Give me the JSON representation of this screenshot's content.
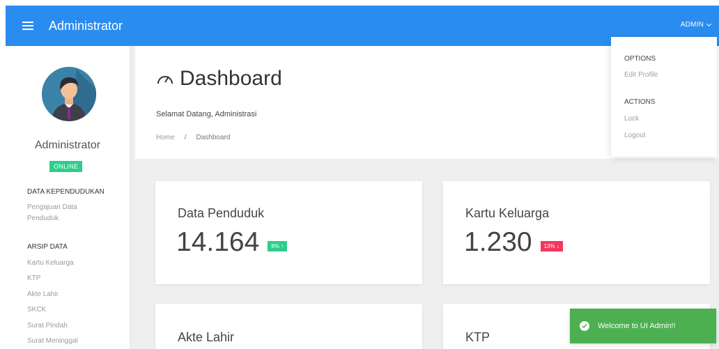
{
  "topbar": {
    "title": "Administrator",
    "user_menu_label": "ADMIN"
  },
  "sidebar": {
    "user_name": "Administrator",
    "status": "ONLINE",
    "sections": [
      {
        "header": "DATA KEPENDUDUKAN",
        "items": [
          "Pengajuan Data Penduduk"
        ]
      },
      {
        "header": "ARSIP DATA",
        "items": [
          "Kartu Keluarga",
          "KTP",
          "Akte Lahir",
          "SKCK",
          "Surat Pindah",
          "Surat Meninggal"
        ]
      }
    ]
  },
  "header": {
    "title": "Dashboard",
    "welcome": "Selamat Datang, Administrasi",
    "breadcrumb": [
      "Home",
      "/",
      "Dashboard"
    ]
  },
  "dropdown": {
    "options_header": "OPTIONS",
    "options": [
      "Edit Profile"
    ],
    "actions_header": "ACTIONS",
    "actions": [
      "Lock",
      "Logout"
    ]
  },
  "cards": [
    {
      "title": "Data Penduduk",
      "value": "14.164",
      "trend": "8%",
      "trend_dir": "up"
    },
    {
      "title": "Kartu Keluarga",
      "value": "1.230",
      "trend": "13%",
      "trend_dir": "down"
    },
    {
      "title": "Akte Lahir"
    },
    {
      "title": "KTP"
    }
  ],
  "toast": {
    "message": "Welcome to UI Admin!!"
  },
  "colors": {
    "primary": "#2b8cf0",
    "success": "#2dce89",
    "danger": "#f5365c",
    "toast": "#4caf50"
  }
}
